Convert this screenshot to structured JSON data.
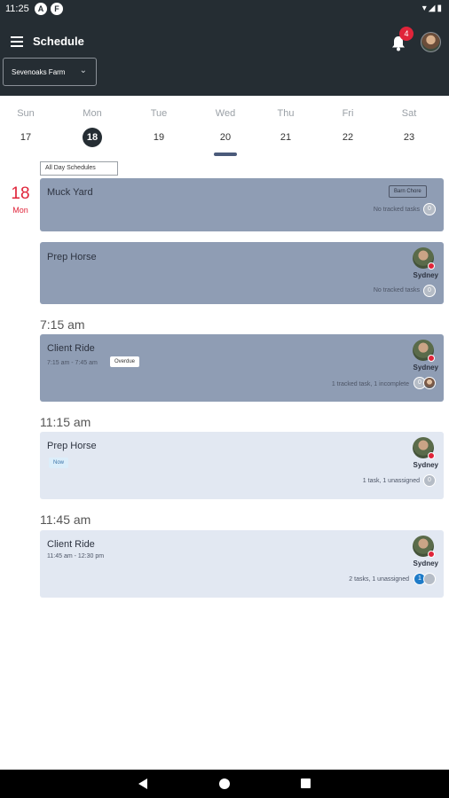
{
  "status_bar": {
    "time": "11:25",
    "app_icons": [
      "A",
      "F"
    ],
    "right_icons": "▾◢▮"
  },
  "app_bar": {
    "title": "Schedule",
    "notification_count": "4",
    "farm": "Sevenoaks Farm"
  },
  "week": {
    "days": [
      {
        "name": "Sun",
        "num": "17"
      },
      {
        "name": "Mon",
        "num": "18"
      },
      {
        "name": "Tue",
        "num": "19"
      },
      {
        "name": "Wed",
        "num": "20"
      },
      {
        "name": "Thu",
        "num": "21"
      },
      {
        "name": "Fri",
        "num": "22"
      },
      {
        "name": "Sat",
        "num": "23"
      }
    ]
  },
  "schedule": {
    "all_day_label": "All Day Schedules",
    "date_num": "18",
    "date_weekday": "Mon",
    "all_day_cards": [
      {
        "title": "Muck Yard",
        "tag": "Barn Chore",
        "tasks": "No tracked tasks",
        "count": "0"
      },
      {
        "title": "Prep Horse",
        "assignee": "Sydney",
        "tasks": "No tracked tasks",
        "count": "0"
      }
    ],
    "timed": [
      {
        "time": "7:15 am",
        "title": "Client Ride",
        "range": "7:15 am - 7:45 am",
        "tag": "Overdue",
        "assignee": "Sydney",
        "tasks": "1 tracked task, 1 incomplete",
        "count": "0"
      },
      {
        "time": "11:15 am",
        "title": "Prep Horse",
        "tag": "Now",
        "assignee": "Sydney",
        "tasks": "1 task, 1 unassigned",
        "count": "0"
      },
      {
        "time": "11:45 am",
        "title": "Client Ride",
        "range": "11:45 am - 12:30 pm",
        "assignee": "Sydney",
        "tasks": "2 tasks, 1 unassigned",
        "count": "1"
      }
    ]
  },
  "colors": {
    "app_bar": "#252d33",
    "accent_red": "#e0243a",
    "card_dark": "#8f9db4",
    "card_light": "#e2e8f2",
    "task_blue": "#1e7bc8"
  }
}
